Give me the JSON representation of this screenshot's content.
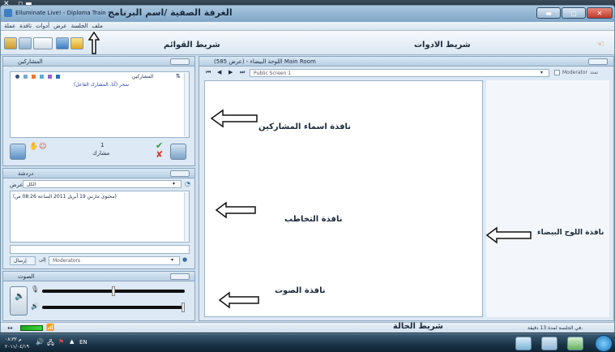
{
  "window": {
    "title_prefix": "Elluminate Live! - Diploma Train",
    "title_overlay": "الغرفة الصفية /اسم البرنامج"
  },
  "menubar": {
    "items": [
      "عملة",
      "نافذة",
      "أدوات",
      "عرض",
      "الجلسة",
      "ملف"
    ]
  },
  "toolbar_labels": {
    "menus_bar": "شريط القوائم",
    "tools_bar": "شريط الادوات"
  },
  "participants": {
    "title": "المشاركين",
    "column_header": "المشاركين",
    "entry": "سحر (أنا، المشارك الفاعل)",
    "count": "1",
    "count_label": "مشارك"
  },
  "chat": {
    "title": "دردشة",
    "filter_label": "عرض",
    "filter_value": "الكل",
    "message": "(محتوى مارس 19 أبريل 2011 الساعة 08:26 ص)",
    "to_label": "إلى",
    "to_value": "Moderators",
    "send_label": "إرسال"
  },
  "audio": {
    "title": "الصوت"
  },
  "whiteboard": {
    "title": "اللوحة البيضاء - (عرض 585) Main Room",
    "screen_name": "Public Screen 1",
    "moderator_label": "Moderator",
    "moderator_tail": "تمتد"
  },
  "annotations": {
    "participants_window": "نافذة اسماء المشاركين",
    "chat_window": "نافذة التخاطب",
    "audio_window": "نافذة الصوت",
    "whiteboard_window": "نافذة اللوح البيضاء"
  },
  "status": {
    "status_bar": "شريط الحالة",
    "session_time": "في الجلسة لمدة 13 دقيقة."
  },
  "taskbar": {
    "lang": "EN",
    "time": "م ٠٨:٣٢",
    "date": "٢٠١١/٠٤/١٩"
  }
}
